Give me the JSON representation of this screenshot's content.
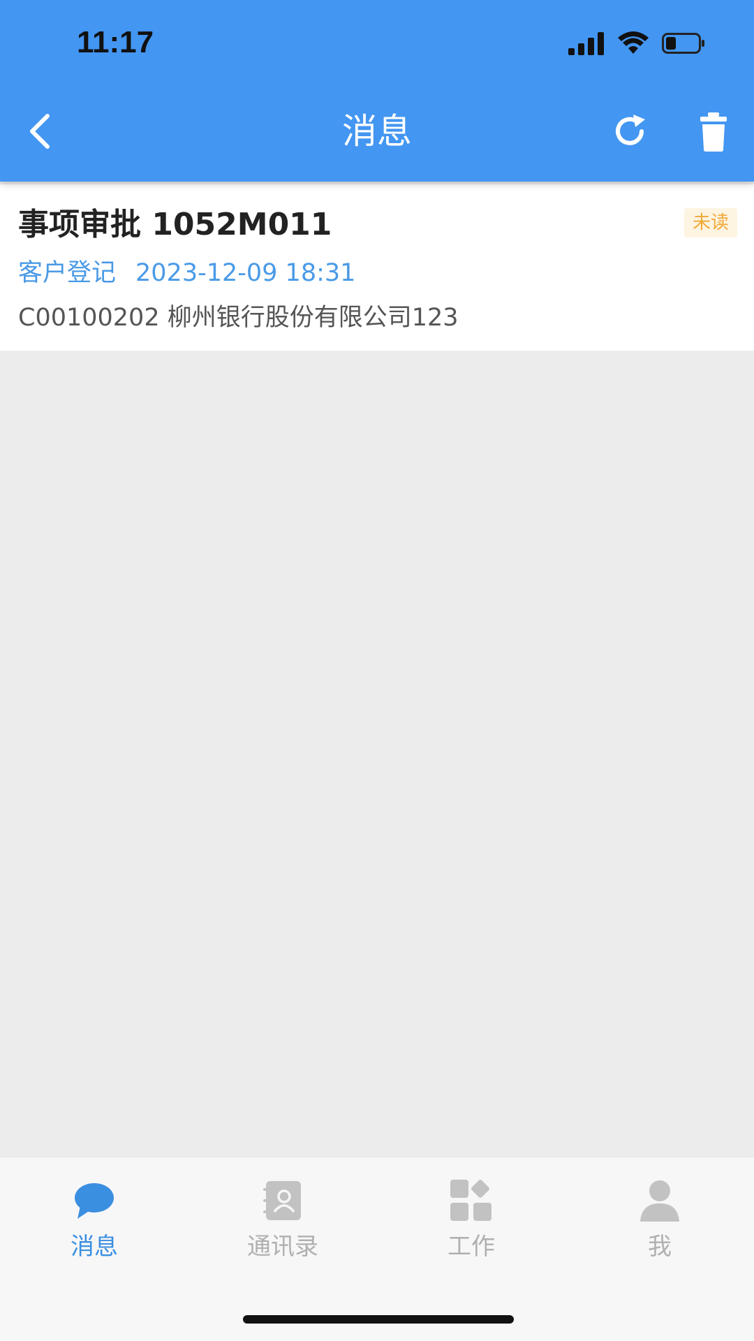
{
  "status_bar": {
    "time": "11:17"
  },
  "nav": {
    "title": "消息",
    "back_icon": "chevron-left-icon",
    "refresh_icon": "refresh-icon",
    "delete_icon": "trash-icon"
  },
  "messages": [
    {
      "title": "事项审批 1052M011",
      "badge": "未读",
      "category": "客户登记",
      "date": "2023-12-09 18:31",
      "body": "C00100202 柳州银行股份有限公司123"
    }
  ],
  "tabbar": {
    "items": [
      {
        "label": "消息",
        "icon": "chat-bubble-icon",
        "active": true
      },
      {
        "label": "通讯录",
        "icon": "contacts-book-icon",
        "active": false
      },
      {
        "label": "工作",
        "icon": "apps-grid-icon",
        "active": false
      },
      {
        "label": "我",
        "icon": "person-icon",
        "active": false
      }
    ]
  },
  "colors": {
    "header": "#4396f2",
    "accent": "#3b8fe0",
    "badge_text": "#f2a838",
    "badge_bg": "#fdf4e2",
    "background": "#ececed"
  }
}
